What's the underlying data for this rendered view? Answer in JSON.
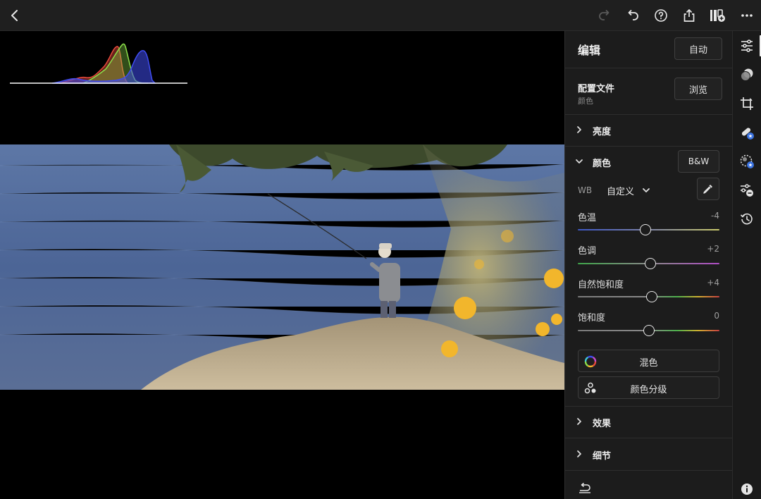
{
  "toolbar": {
    "icons": [
      "back-icon",
      "redo-icon",
      "undo-icon",
      "help-icon",
      "share-icon",
      "add-to-album-icon",
      "more-icon"
    ]
  },
  "panel": {
    "title": "编辑",
    "auto_label": "自动",
    "profile": {
      "label": "配置文件",
      "value": "颜色",
      "browse_label": "浏览"
    },
    "sections": {
      "light": {
        "label": "亮度",
        "expanded": false
      },
      "color": {
        "label": "颜色",
        "expanded": true,
        "bw_label": "B&W"
      },
      "effects": {
        "label": "效果",
        "expanded": false
      },
      "detail": {
        "label": "细节",
        "expanded": false
      }
    },
    "wb": {
      "label": "WB",
      "value": "自定义"
    },
    "sliders": [
      {
        "label": "色温",
        "value": "-4",
        "position": 0.48
      },
      {
        "label": "色调",
        "value": "+2",
        "position": 0.51
      },
      {
        "label": "自然饱和度",
        "value": "+4",
        "position": 0.52
      },
      {
        "label": "饱和度",
        "value": "0",
        "position": 0.5
      }
    ],
    "mix_label": "混色",
    "grading_label": "颜色分级"
  },
  "rail": {
    "icons": [
      "edit-sliders-icon",
      "presets-icon",
      "crop-icon",
      "healing-icon",
      "masking-icon",
      "versions-icon",
      "history-icon",
      "info-icon"
    ],
    "active": "edit-sliders-icon"
  },
  "colors": {
    "accent_blue": "#3b73e0",
    "histogram_red": "#e84a3c",
    "histogram_green": "#8ce04a",
    "histogram_blue": "#3f4cf0"
  }
}
